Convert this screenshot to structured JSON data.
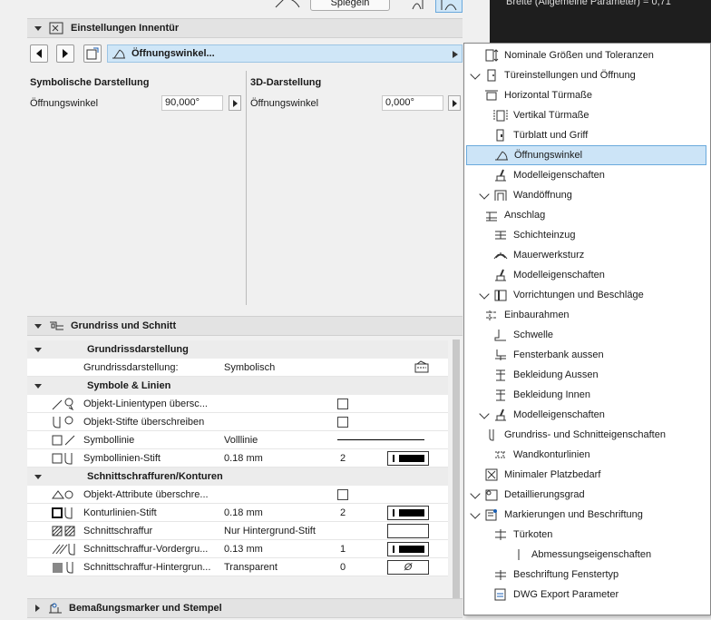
{
  "topbar": {
    "mirror_label": "Spiegeln",
    "right_text": "Breite (Allgemeine Parameter) = 0,71"
  },
  "door_settings": {
    "header": "Einstellungen Innentür",
    "nav_current": "Öffnungswinkel...",
    "symbolic": {
      "title": "Symbolische Darstellung",
      "label": "Öffnungswinkel",
      "value": "90,000°"
    },
    "three_d": {
      "title": "3D-Darstellung",
      "label": "Öffnungswinkel",
      "value": "0,000°"
    }
  },
  "floorplan": {
    "header": "Grundriss und Schnitt",
    "groups": [
      {
        "title": "Grundrissdarstellung"
      },
      {
        "title": "Symbole & Linien"
      },
      {
        "title": "Schnittschraffuren/Konturen"
      }
    ],
    "rows": [
      {
        "label": "Grundrissdarstellung:",
        "value": "Symbolisch",
        "extra": ""
      },
      {
        "label": "Objekt-Linientypen übersc...",
        "value": "",
        "extra": ""
      },
      {
        "label": "Objekt-Stifte überschreiben",
        "value": "",
        "extra": ""
      },
      {
        "label": "Symbollinie",
        "value": "Volllinie",
        "extra": ""
      },
      {
        "label": "Symbollinien-Stift",
        "value": "0.18 mm",
        "extra": "2"
      },
      {
        "label": "Objekt-Attribute überschre...",
        "value": "",
        "extra": ""
      },
      {
        "label": "Konturlinien-Stift",
        "value": "0.18 mm",
        "extra": "2"
      },
      {
        "label": "Schnittschraffur",
        "value": "Nur Hintergrund-Stift",
        "extra": ""
      },
      {
        "label": "Schnittschraffur-Vordergru...",
        "value": "0.13 mm",
        "extra": "1"
      },
      {
        "label": "Schnittschraffur-Hintergrun...",
        "value": "Transparent",
        "extra": "0"
      }
    ],
    "empty_pen_symbol": "Ø"
  },
  "dimensions": {
    "header": "Bemaßungsmarker und Stempel"
  },
  "menu": {
    "items": [
      {
        "label": "Nominale Größen und Toleranzen",
        "icon": "dimension-icon"
      },
      {
        "label": "Türeinstellungen und Öffnung",
        "icon": "door-icon"
      },
      {
        "label": "Horizontal Türmaße",
        "icon": "horizontal-dims-icon"
      },
      {
        "label": "Vertikal Türmaße",
        "icon": "vertical-dims-icon"
      },
      {
        "label": "Türblatt und Griff",
        "icon": "door-leaf-icon"
      },
      {
        "label": "Öffnungswinkel",
        "icon": "opening-angle-icon"
      },
      {
        "label": "Modelleigenschaften",
        "icon": "brush-icon"
      },
      {
        "label": "Wandöffnung",
        "icon": "wall-opening-icon"
      },
      {
        "label": "Anschlag",
        "icon": "stop-icon"
      },
      {
        "label": "Schichteinzug",
        "icon": "layer-icon"
      },
      {
        "label": "Mauerwerksturz",
        "icon": "arch-icon"
      },
      {
        "label": "Modelleigenschaften",
        "icon": "brush-icon"
      },
      {
        "label": "Vorrichtungen und Beschläge",
        "icon": "fittings-icon"
      },
      {
        "label": "Einbaurahmen",
        "icon": "frame-icon"
      },
      {
        "label": "Schwelle",
        "icon": "threshold-icon"
      },
      {
        "label": "Fensterbank aussen",
        "icon": "sill-icon"
      },
      {
        "label": "Bekleidung Aussen",
        "icon": "casing-icon"
      },
      {
        "label": "Bekleidung Innen",
        "icon": "casing-icon"
      },
      {
        "label": "Modelleigenschaften",
        "icon": "brush-icon"
      },
      {
        "label": "Grundriss- und Schnitteigenschaften",
        "icon": "plan-section-icon"
      },
      {
        "label": "Wandkonturlinien",
        "icon": "contour-icon"
      },
      {
        "label": "Minimaler Platzbedarf",
        "icon": "min-space-icon"
      },
      {
        "label": "Detaillierungsgrad",
        "icon": "detail-icon"
      },
      {
        "label": "Markierungen und Beschriftung",
        "icon": "marker-icon"
      },
      {
        "label": "Türkoten",
        "icon": "elevation-icon"
      },
      {
        "label": "Abmessungseigenschaften",
        "icon": "dimension-props-icon"
      },
      {
        "label": "Beschriftung Fenstertyp",
        "icon": "label-icon"
      },
      {
        "label": "DWG Export Parameter",
        "icon": "dwg-icon"
      }
    ]
  }
}
